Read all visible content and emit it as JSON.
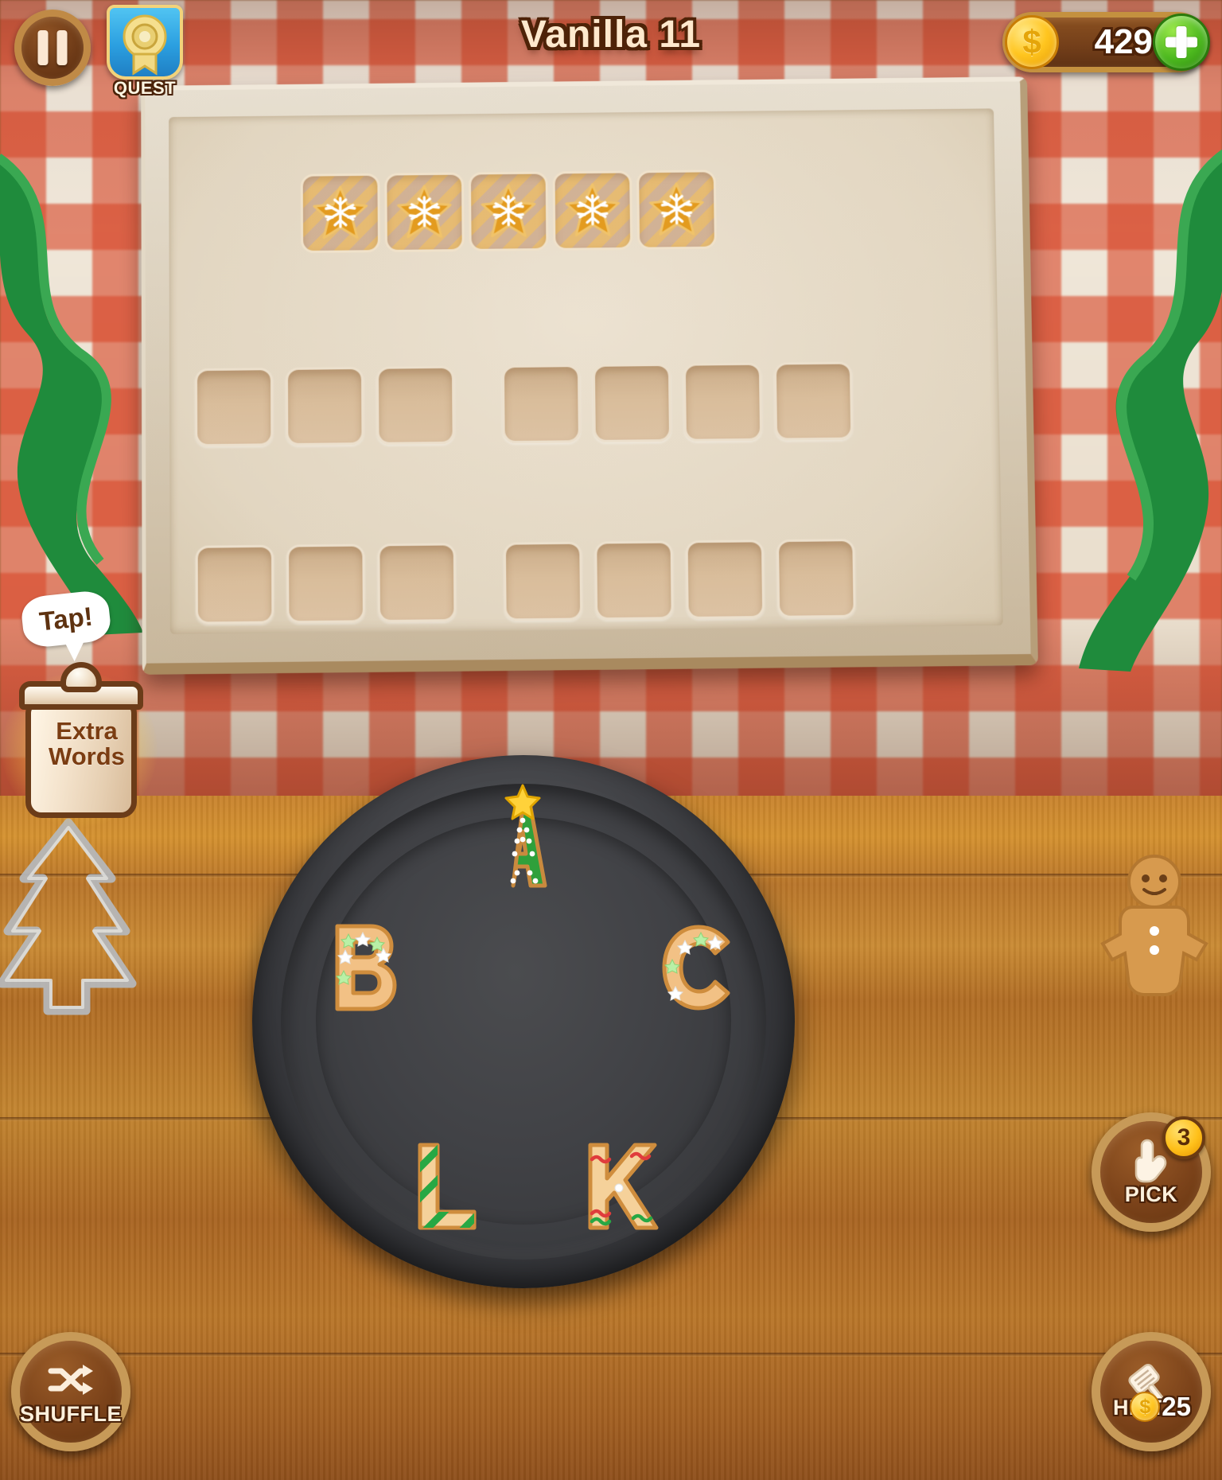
{
  "header": {
    "level_title": "Vanilla 11",
    "pause_icon": "pause-icon",
    "quest_label": "QUEST",
    "quest_icon": "rosette-badge-icon",
    "coins": {
      "amount": "429",
      "coin_icon": "coin-icon",
      "add_icon": "plus-icon"
    }
  },
  "board": {
    "solved_row": {
      "count": 5,
      "tile_icon": "snowflake-star-cookie-icon",
      "tiles": [
        "",
        "",
        "",
        "",
        ""
      ]
    },
    "word_rows": [
      {
        "slots": 7,
        "gap_after_index": 2
      },
      {
        "slots": 7,
        "gap_after_index": 2
      }
    ]
  },
  "extra_words": {
    "tooltip": "Tap!",
    "line1": "Extra",
    "line2": "Words",
    "jar_icon": "cookie-jar-icon"
  },
  "letters": [
    {
      "char": "A",
      "style": "green-tree",
      "topper": "star"
    },
    {
      "char": "B",
      "style": "plain-sprinkles",
      "topper": "none"
    },
    {
      "char": "C",
      "style": "plain-sprinkles",
      "topper": "none"
    },
    {
      "char": "K",
      "style": "red-stripes",
      "topper": "none"
    },
    {
      "char": "L",
      "style": "green-stripes",
      "topper": "none"
    }
  ],
  "buttons": {
    "shuffle": {
      "label": "SHUFFLE",
      "icon": "shuffle-icon"
    },
    "pick": {
      "label": "PICK",
      "icon": "pointing-hand-icon",
      "count": "3"
    },
    "hint": {
      "label": "HINT",
      "icon": "spatula-icon",
      "cost": "25",
      "coin_icon": "coin-icon"
    }
  },
  "decor": {
    "ribbon": "green-ribbon",
    "cookie_cutter": "tree-cookie-cutter-icon",
    "gingerbread": "gingerbread-man-icon"
  },
  "colors": {
    "accent_green": "#4cb81e",
    "wood": "#7c431a",
    "wood_rim": "#c79a58",
    "coin_gold": "#ffc51f",
    "board_paper": "#e2d6c1",
    "tile_empty": "#d9bd9b",
    "title_text": "#ffe9cd"
  }
}
